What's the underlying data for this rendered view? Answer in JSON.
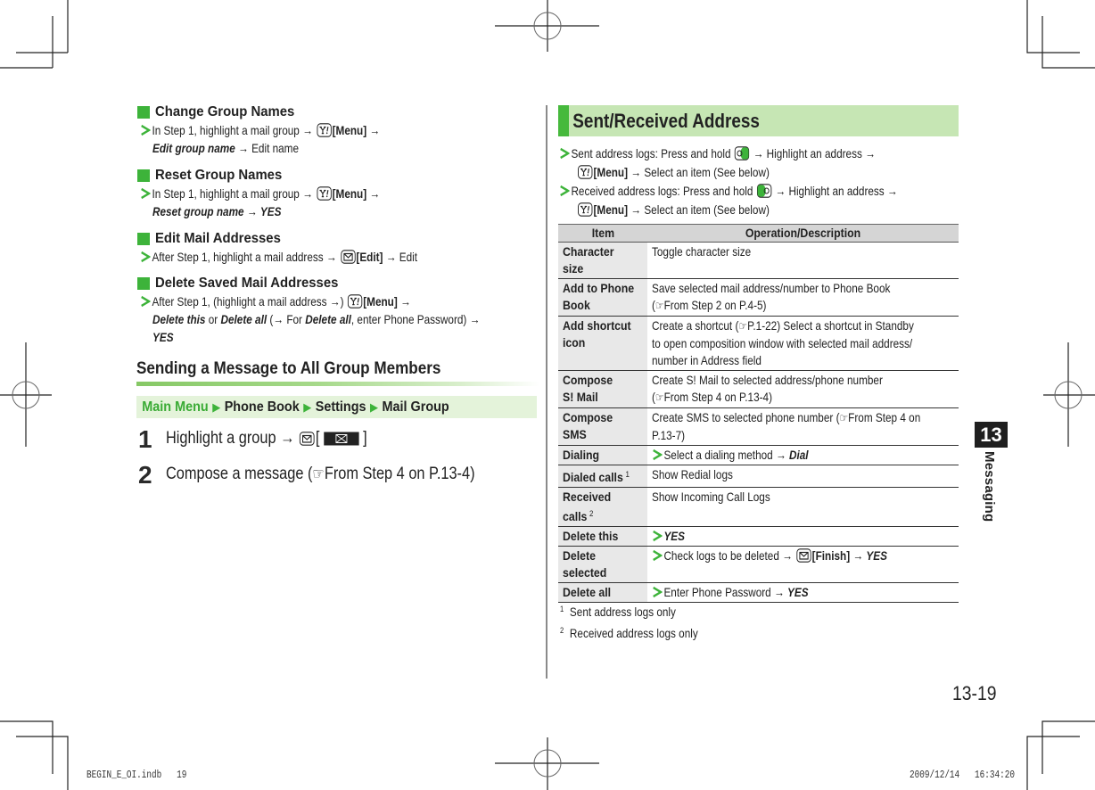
{
  "left": {
    "sections": [
      {
        "title": "Change Group Names",
        "lines": [
          [
            {
              "icon": "bullet-chevron"
            },
            {
              "text": "In Step 1, highlight a mail group → "
            },
            {
              "icon": "menu-key"
            },
            {
              "text": "[Menu]",
              "style": "b"
            },
            {
              "text": " →"
            }
          ],
          [
            {
              "text": "Edit group name",
              "style": "bi"
            },
            {
              "text": " → Edit name"
            }
          ]
        ]
      },
      {
        "title": "Reset Group Names",
        "lines": [
          [
            {
              "icon": "bullet-chevron"
            },
            {
              "text": "In Step 1, highlight a mail group → "
            },
            {
              "icon": "menu-key"
            },
            {
              "text": "[Menu]",
              "style": "b"
            },
            {
              "text": " →"
            }
          ],
          [
            {
              "text": "Reset group name",
              "style": "bi"
            },
            {
              "text": " → "
            },
            {
              "text": "YES",
              "style": "bi"
            }
          ]
        ]
      },
      {
        "title": "Edit Mail Addresses",
        "lines": [
          [
            {
              "icon": "bullet-chevron"
            },
            {
              "text": "After Step 1, highlight a mail address → "
            },
            {
              "icon": "mail-key"
            },
            {
              "text": "[Edit]",
              "style": "b"
            },
            {
              "text": " → Edit"
            }
          ]
        ]
      },
      {
        "title": "Delete Saved Mail Addresses",
        "lines": [
          [
            {
              "icon": "bullet-chevron"
            },
            {
              "text": "After Step 1, (highlight a mail address →) "
            },
            {
              "icon": "menu-key"
            },
            {
              "text": "[Menu]",
              "style": "b"
            },
            {
              "text": " →"
            }
          ],
          [
            {
              "text": "Delete this",
              "style": "bi"
            },
            {
              "text": " or "
            },
            {
              "text": "Delete all",
              "style": "bi"
            },
            {
              "text": " (→ For "
            },
            {
              "text": "Delete all",
              "style": "bi"
            },
            {
              "text": ", enter Phone Password) →"
            }
          ],
          [
            {
              "text": "YES",
              "style": "bi"
            }
          ]
        ]
      }
    ],
    "sending": {
      "title": "Sending a Message to All Group Members",
      "breadcrumb": [
        "Main Menu",
        "Phone Book",
        "Settings",
        "Mail Group"
      ],
      "steps": [
        {
          "num": "1",
          "lines": [
            [
              {
                "text": "Highlight a group → "
              },
              {
                "icon": "mail-key"
              },
              {
                "text": "[ "
              },
              {
                "icon": "mail-softkey"
              },
              {
                "text": " ]"
              }
            ]
          ]
        },
        {
          "num": "2",
          "lines": [
            [
              {
                "text": "Compose a message ("
              },
              {
                "text": "☞",
                "style": "ref"
              },
              {
                "text": "From Step 4 on P.13-4)"
              }
            ]
          ]
        }
      ]
    }
  },
  "right": {
    "title": "Sent/Received Address",
    "bullets": [
      {
        "lines": [
          [
            {
              "icon": "bullet-chevron"
            },
            {
              "text": "Sent address logs: Press and hold "
            },
            {
              "icon": "sent-log-key"
            },
            {
              "text": " → Highlight an address →"
            }
          ],
          [
            {
              "icon": "menu-key"
            },
            {
              "text": "[Menu]",
              "style": "b"
            },
            {
              "text": " → Select an item (See below)"
            }
          ]
        ]
      },
      {
        "lines": [
          [
            {
              "icon": "bullet-chevron"
            },
            {
              "text": "Received address logs: Press and hold "
            },
            {
              "icon": "received-log-key"
            },
            {
              "text": " → Highlight an address →"
            }
          ],
          [
            {
              "icon": "menu-key"
            },
            {
              "text": "[Menu]",
              "style": "b"
            },
            {
              "text": " → Select an item (See below)"
            }
          ]
        ]
      }
    ],
    "table": {
      "headers": [
        "Item",
        "Operation/Description"
      ],
      "rows": [
        {
          "item": [
            "Character",
            "size"
          ],
          "desc": [
            [
              {
                "text": "Toggle character size"
              }
            ]
          ]
        },
        {
          "item": [
            "Add to Phone",
            "Book"
          ],
          "desc": [
            [
              {
                "text": "Save selected mail address/number to Phone Book"
              }
            ],
            [
              {
                "text": "("
              },
              {
                "text": "☞",
                "style": "ref"
              },
              {
                "text": "From Step 2 on P.4-5)"
              }
            ]
          ]
        },
        {
          "item": [
            "Add shortcut",
            "icon"
          ],
          "desc": [
            [
              {
                "text": "Create a shortcut ("
              },
              {
                "text": "☞",
                "style": "ref"
              },
              {
                "text": "P.1-22) Select a shortcut in Standby"
              }
            ],
            [
              {
                "text": "to open composition window with selected mail address/"
              }
            ],
            [
              {
                "text": "number in Address field"
              }
            ]
          ]
        },
        {
          "item": [
            "Compose",
            "S! Mail"
          ],
          "desc": [
            [
              {
                "text": "Create S! Mail to selected address/phone number"
              }
            ],
            [
              {
                "text": "("
              },
              {
                "text": "☞",
                "style": "ref"
              },
              {
                "text": "From Step 4 on P.13-4)"
              }
            ]
          ]
        },
        {
          "item": [
            "Compose",
            "SMS"
          ],
          "desc": [
            [
              {
                "text": "Create SMS to selected phone number ("
              },
              {
                "text": "☞",
                "style": "ref"
              },
              {
                "text": "From Step 4 on"
              }
            ],
            [
              {
                "text": "P.13-7)"
              }
            ]
          ]
        },
        {
          "item": [
            "Dialing"
          ],
          "desc": [
            [
              {
                "icon": "bullet-chevron"
              },
              {
                "text": "Select a dialing method → "
              },
              {
                "text": "Dial",
                "style": "bi"
              }
            ]
          ]
        },
        {
          "item": [
            "Dialed calls"
          ],
          "sup": "1",
          "desc": [
            [
              {
                "text": "Show Redial logs"
              }
            ]
          ]
        },
        {
          "item": [
            "Received",
            "calls"
          ],
          "sup": "2",
          "desc": [
            [
              {
                "text": "Show Incoming Call Logs"
              }
            ]
          ]
        },
        {
          "item": [
            "Delete this"
          ],
          "desc": [
            [
              {
                "icon": "bullet-chevron"
              },
              {
                "text": "YES",
                "style": "bi"
              }
            ]
          ]
        },
        {
          "item": [
            "Delete",
            "selected"
          ],
          "desc": [
            [
              {
                "icon": "bullet-chevron"
              },
              {
                "text": "Check logs to be deleted → "
              },
              {
                "icon": "mail-key"
              },
              {
                "text": "[Finish]",
                "style": "b"
              },
              {
                "text": " → "
              },
              {
                "text": "YES",
                "style": "bi"
              }
            ]
          ]
        },
        {
          "item": [
            "Delete all"
          ],
          "desc": [
            [
              {
                "icon": "bullet-chevron"
              },
              {
                "text": "Enter Phone Password → "
              },
              {
                "text": "YES",
                "style": "bi"
              }
            ]
          ]
        }
      ]
    },
    "footnotes": [
      {
        "mark": "1",
        "text": "Sent address logs only"
      },
      {
        "mark": "2",
        "text": "Received address logs only"
      }
    ]
  },
  "side_tab": {
    "chapter": "13",
    "label": "Messaging"
  },
  "page_number": "13-19",
  "print_slug": {
    "file": "BEGIN_E_OI.indb",
    "page": "19",
    "date": "2009/12/14",
    "time": "16:34:20"
  },
  "colors": {
    "accent_green": "#3db33a",
    "heading_bg": "#c6e6b4",
    "breadcrumb_bg": "#e4f3da",
    "table_header_bg": "#d5d5d5",
    "item_col_bg": "#e8e8e8"
  }
}
